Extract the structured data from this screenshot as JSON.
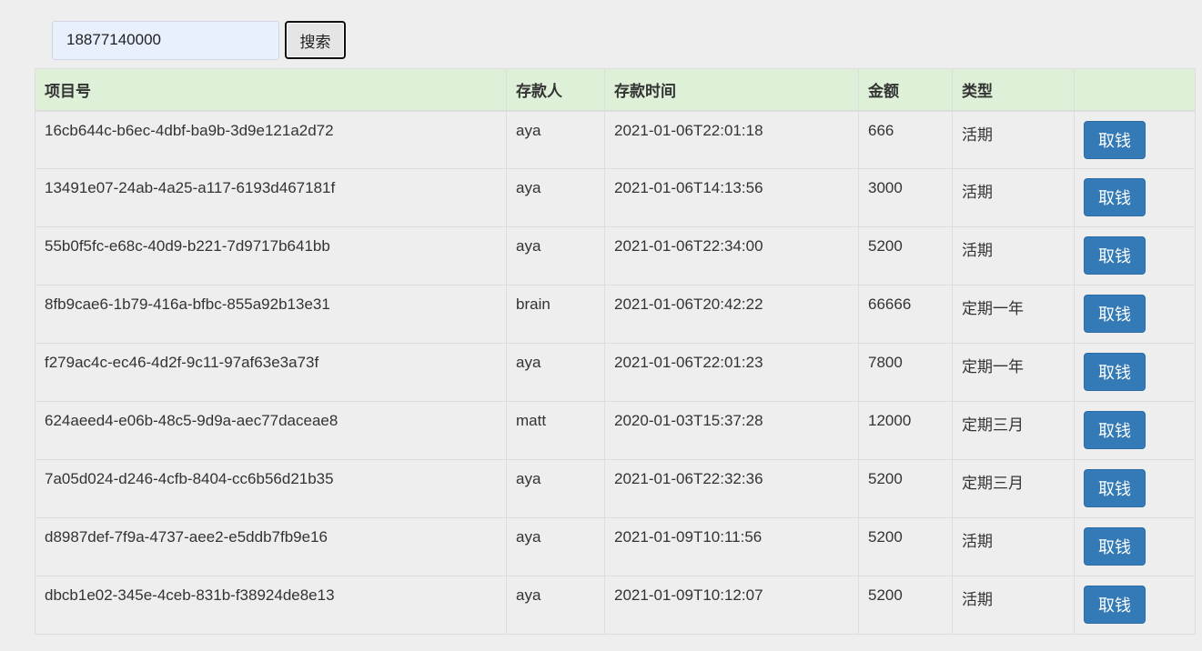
{
  "search": {
    "value": "18877140000",
    "button_label": "搜索"
  },
  "table": {
    "headers": [
      "项目号",
      "存款人",
      "存款时间",
      "金额",
      "类型",
      ""
    ],
    "rows": [
      {
        "id": "16cb644c-b6ec-4dbf-ba9b-3d9e121a2d72",
        "depositor": "aya",
        "time": "2021-01-06T22:01:18",
        "amount": "666",
        "type": "活期",
        "action": "取钱"
      },
      {
        "id": "13491e07-24ab-4a25-a117-6193d467181f",
        "depositor": "aya",
        "time": "2021-01-06T14:13:56",
        "amount": "3000",
        "type": "活期",
        "action": "取钱"
      },
      {
        "id": "55b0f5fc-e68c-40d9-b221-7d9717b641bb",
        "depositor": "aya",
        "time": "2021-01-06T22:34:00",
        "amount": "5200",
        "type": "活期",
        "action": "取钱"
      },
      {
        "id": "8fb9cae6-1b79-416a-bfbc-855a92b13e31",
        "depositor": "brain",
        "time": "2021-01-06T20:42:22",
        "amount": "66666",
        "type": "定期一年",
        "action": "取钱"
      },
      {
        "id": "f279ac4c-ec46-4d2f-9c11-97af63e3a73f",
        "depositor": "aya",
        "time": "2021-01-06T22:01:23",
        "amount": "7800",
        "type": "定期一年",
        "action": "取钱"
      },
      {
        "id": "624aeed4-e06b-48c5-9d9a-aec77daceae8",
        "depositor": "matt",
        "time": "2020-01-03T15:37:28",
        "amount": "12000",
        "type": "定期三月",
        "action": "取钱"
      },
      {
        "id": "7a05d024-d246-4cfb-8404-cc6b56d21b35",
        "depositor": "aya",
        "time": "2021-01-06T22:32:36",
        "amount": "5200",
        "type": "定期三月",
        "action": "取钱"
      },
      {
        "id": "d8987def-7f9a-4737-aee2-e5ddb7fb9e16",
        "depositor": "aya",
        "time": "2021-01-09T10:11:56",
        "amount": "5200",
        "type": "活期",
        "action": "取钱"
      },
      {
        "id": "dbcb1e02-345e-4ceb-831b-f38924de8e13",
        "depositor": "aya",
        "time": "2021-01-09T10:12:07",
        "amount": "5200",
        "type": "活期",
        "action": "取钱"
      }
    ]
  },
  "colors": {
    "page_background": "#eeeeee",
    "header_background": "#dff0d8",
    "primary_button": "#337ab7",
    "input_background": "#e8f0fe"
  }
}
